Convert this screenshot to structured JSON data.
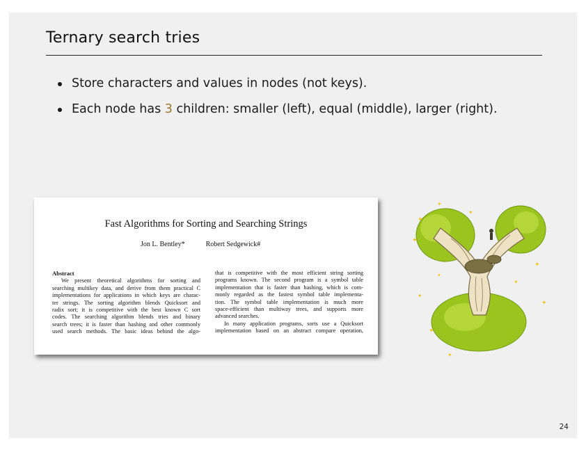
{
  "slide": {
    "title": "Ternary search tries",
    "bullets": [
      {
        "text": "Store characters and values in nodes (not keys)."
      },
      {
        "pre": "Each node has ",
        "accent": "3",
        "post": " children:  smaller (left), equal (middle), larger (right)."
      }
    ],
    "page_number": "24"
  },
  "paper": {
    "title": "Fast Algorithms for Sorting and Searching Strings",
    "author1": "Jon L. Bentley*",
    "author2": "Robert Sedgewick#",
    "abstract_heading": "Abstract",
    "left_lines": [
      "We present theoretical algorithms for sorting and",
      "searching multikey data, and derive from them practical C",
      "implementations for applications in which keys are charac-",
      "ter strings.  The sorting algorithm blends Quicksort and",
      "radix sort; it is competitive with the best known C sort",
      "codes.  The searching algorithm blends tries and binary",
      "search trees; it is faster than hashing and other commonly",
      "used search methods.  The basic ideas behind the algo-"
    ],
    "right_lines": [
      "that is competitive with the most efficient string sorting",
      "programs known.  The second program is a symbol table",
      "implementation that is faster than hashing, which is com-",
      "monly regarded as the fastest symbol table implementa-",
      "tion.  The symbol table implementation is much more",
      "space-efficient than multiway trees, and supports more",
      "advanced searches.",
      "In many application programs, sorts use a Quicksort",
      "implementation based on an abstract compare operation,"
    ]
  },
  "colors": {
    "accent": "#a0762b",
    "foliage": "#9bc41e",
    "star": "#f0c419"
  },
  "illustration": {
    "name": "baobab-tree-illustration"
  }
}
